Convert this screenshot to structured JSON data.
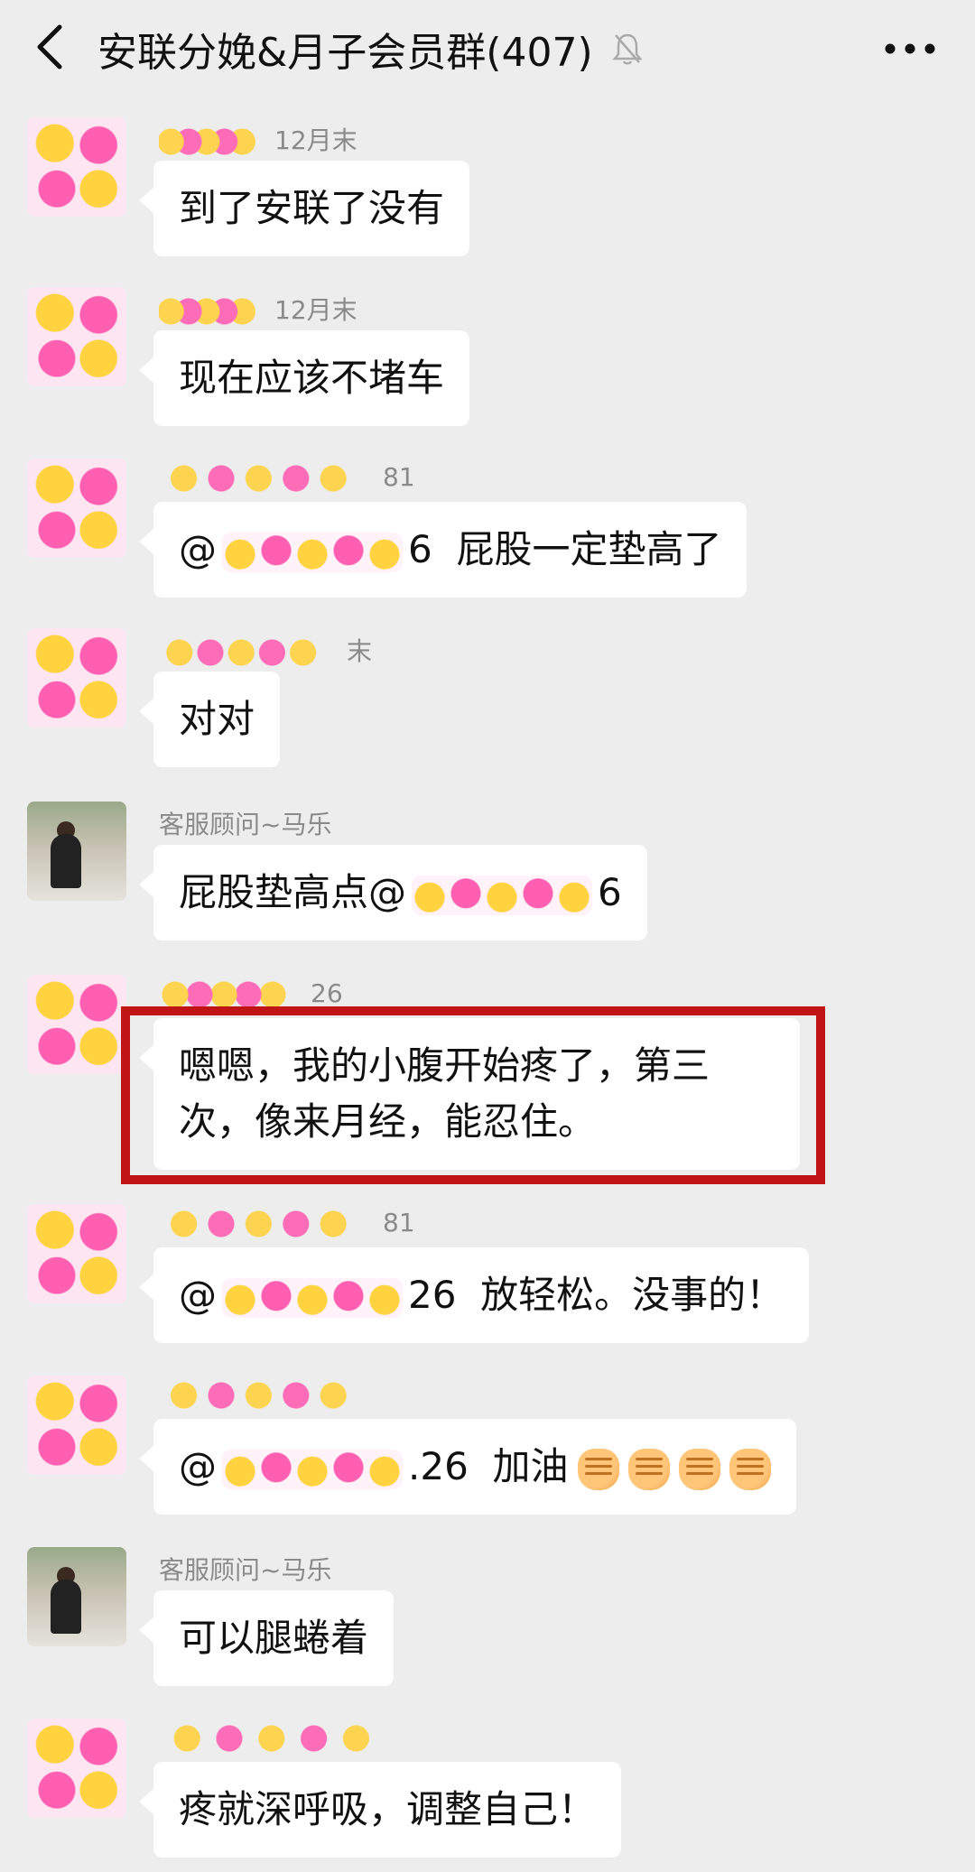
{
  "header": {
    "title": "安联分娩&月子会员群(407)"
  },
  "messages": [
    {
      "sender_suffix": "12月末",
      "text": "到了安联了没有"
    },
    {
      "sender_suffix": "12月末",
      "text": "现在应该不堵车"
    },
    {
      "sender_suffix": "81",
      "mention_prefix": "@",
      "mention_suffix": "6",
      "text": "屁股一定垫高了"
    },
    {
      "sender_suffix": "末",
      "text": "对对"
    },
    {
      "sender": "客服顾问~马乐",
      "text_before": "屁股垫高点@",
      "mention_suffix": "6"
    },
    {
      "sender_suffix": "26",
      "text": "嗯嗯，我的小腹开始疼了，第三次，像来月经，能忍住。"
    },
    {
      "sender_suffix": "81",
      "mention_prefix": "@",
      "mention_suffix": "26",
      "text": "放轻松。没事的！"
    },
    {
      "sender_suffix": "",
      "mention_prefix": "@",
      "mention_suffix": ".26",
      "text": "加油"
    },
    {
      "sender": "客服顾问~马乐",
      "text": "可以腿蜷着"
    },
    {
      "sender_suffix": "",
      "text": "疼就深呼吸，调整自己！"
    }
  ],
  "icons": {
    "back": "chevron-left-icon",
    "mute": "bell-off-icon",
    "more": "more-dots-icon",
    "fist": "raised-fist-emoji"
  },
  "colors": {
    "background": "#ededed",
    "bubble": "#ffffff",
    "highlight": "#c01515",
    "sender": "#8a8a8a"
  }
}
